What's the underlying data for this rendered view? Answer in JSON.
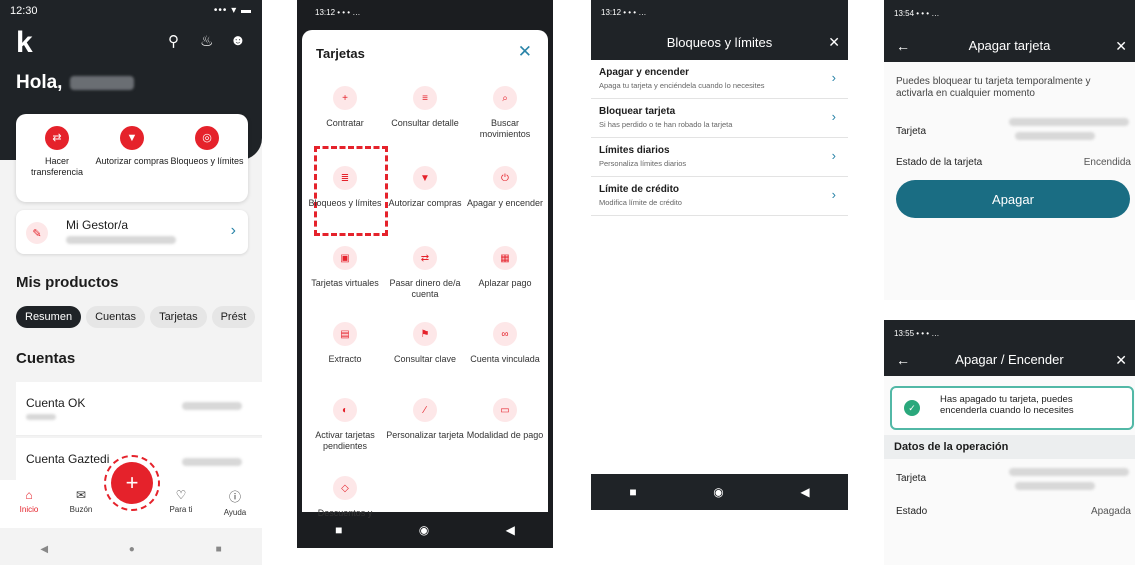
{
  "s1": {
    "time": "12:30",
    "signal": "••• ▾ ▬",
    "logo": "k",
    "greeting": "Hola,",
    "quick": [
      {
        "label": "Hacer transferencia",
        "icon": "⇄"
      },
      {
        "label": "Autorizar compras",
        "icon": "▼"
      },
      {
        "label": "Bloqueos y límites",
        "icon": "◎"
      }
    ],
    "gestor": "Mi Gestor/a",
    "products_title": "Mis productos",
    "chips": [
      "Resumen",
      "Cuentas",
      "Tarjetas",
      "Prést"
    ],
    "accounts_title": "Cuentas",
    "accounts": [
      "Cuenta OK",
      "Cuenta Gaztedi"
    ],
    "tabs": [
      "Inicio",
      "Buzón",
      "",
      "Para ti",
      "Ayuda"
    ],
    "fab": "+"
  },
  "s2": {
    "status": "13:12 • • • …",
    "title": "Tarjetas",
    "close": "✕",
    "items": [
      "Contratar",
      "Consultar detalle",
      "Buscar movimientos",
      "Bloqueos y límites",
      "Autorizar compras",
      "Apagar y encender",
      "Tarjetas virtuales",
      "Pasar dinero de/a cuenta",
      "Aplazar pago",
      "Extracto",
      "Consultar clave",
      "Cuenta vinculada",
      "Activar tarjetas pendientes",
      "Personalizar tarjeta",
      "Modalidad de pago",
      "Descuentos y"
    ],
    "icons": [
      "+",
      "≡",
      "⌕",
      "≣",
      "▼",
      "⏻",
      "▣",
      "⇄",
      "▦",
      "▤",
      "⚑",
      "∞",
      "◐",
      "∕",
      "▭",
      "◇"
    ]
  },
  "s3": {
    "status": "13:12 • • • …",
    "title": "Bloqueos y límites",
    "close": "✕",
    "rows": [
      {
        "t": "Apagar y encender",
        "s": "Apaga tu tarjeta y enciéndela cuando lo necesites"
      },
      {
        "t": "Bloquear tarjeta",
        "s": "Si has perdido o te han robado la tarjeta"
      },
      {
        "t": "Límites diarios",
        "s": "Personaliza límites diarios"
      },
      {
        "t": "Límite de crédito",
        "s": "Modifica límite de crédito"
      }
    ]
  },
  "s4": {
    "status": "13:54 • • • …",
    "title": "Apagar tarjeta",
    "desc": "Puedes bloquear tu tarjeta temporalmente y activarla en cualquier momento",
    "card_label": "Tarjeta",
    "state_label": "Estado de la tarjeta",
    "state_value": "Encendida",
    "button": "Apagar"
  },
  "s5": {
    "status": "13:55 • • • …",
    "title": "Apagar / Encender",
    "msg": "Has apagado tu tarjeta, puedes encenderla cuando lo necesites",
    "section": "Datos de la operación",
    "card_label": "Tarjeta",
    "state_label": "Estado",
    "state_value": "Apagada"
  },
  "colors": {
    "accent": "#e5222b",
    "dark": "#1f2327",
    "teal": "#1a6d83",
    "link": "#2a84a8"
  }
}
